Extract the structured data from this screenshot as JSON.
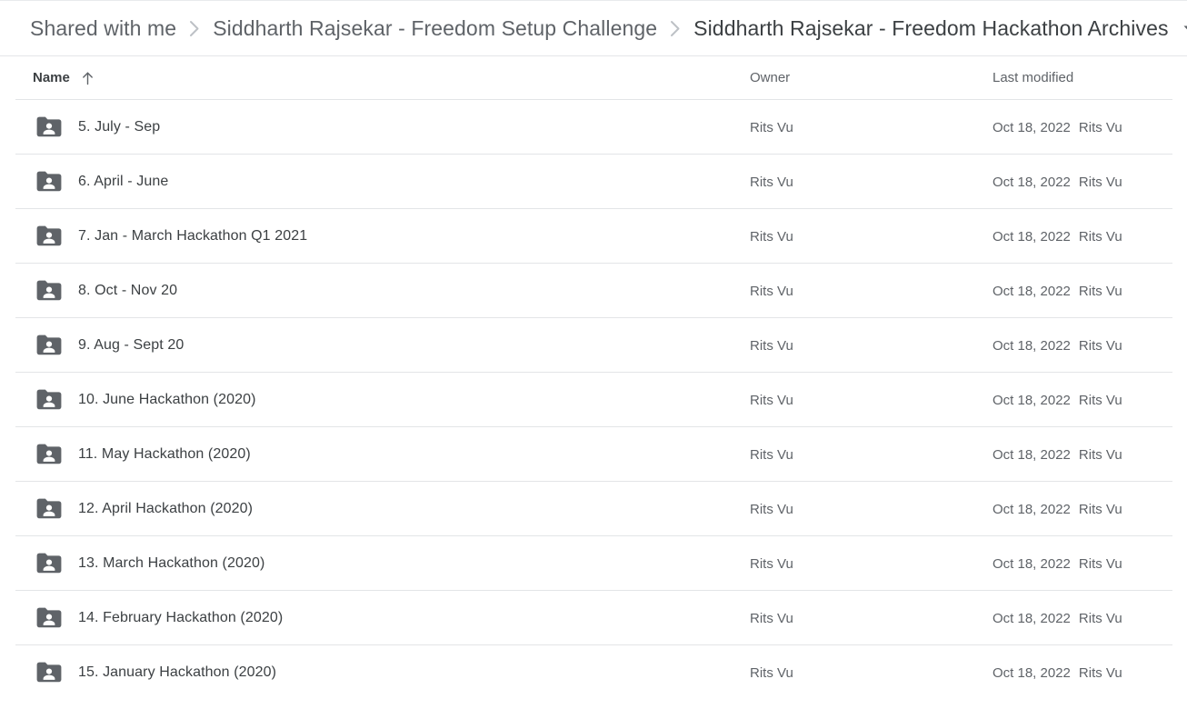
{
  "breadcrumb": {
    "items": [
      {
        "label": "Shared with me",
        "current": false
      },
      {
        "label": "Siddharth Rajsekar - Freedom Setup Challenge",
        "current": false
      },
      {
        "label": "Siddharth Rajsekar - Freedom Hackathon Archives",
        "current": true
      }
    ],
    "separator_icon": "chevron-right-icon",
    "caret_icon": "caret-down-icon"
  },
  "columns": {
    "name": "Name",
    "owner": "Owner",
    "last_modified": "Last modified",
    "sort_icon": "arrow-up-icon",
    "sort_column": "Name",
    "sort_direction": "ascending"
  },
  "colors": {
    "folder_icon": "#5f6368",
    "text_primary": "#3c4043",
    "text_secondary": "#5f6368",
    "divider": "#e3e5e7",
    "breadcrumb_muted": "#5f6368"
  },
  "rows": [
    {
      "icon": "shared-folder-icon",
      "name": "5. July - Sep",
      "owner": "Rits Vu",
      "modified_date": "Oct 18, 2022",
      "modified_by": "Rits Vu"
    },
    {
      "icon": "shared-folder-icon",
      "name": "6. April - June",
      "owner": "Rits Vu",
      "modified_date": "Oct 18, 2022",
      "modified_by": "Rits Vu"
    },
    {
      "icon": "shared-folder-icon",
      "name": "7. Jan - March Hackathon Q1 2021",
      "owner": "Rits Vu",
      "modified_date": "Oct 18, 2022",
      "modified_by": "Rits Vu"
    },
    {
      "icon": "shared-folder-icon",
      "name": "8. Oct - Nov 20",
      "owner": "Rits Vu",
      "modified_date": "Oct 18, 2022",
      "modified_by": "Rits Vu"
    },
    {
      "icon": "shared-folder-icon",
      "name": "9. Aug - Sept 20",
      "owner": "Rits Vu",
      "modified_date": "Oct 18, 2022",
      "modified_by": "Rits Vu"
    },
    {
      "icon": "shared-folder-icon",
      "name": "10. June Hackathon (2020)",
      "owner": "Rits Vu",
      "modified_date": "Oct 18, 2022",
      "modified_by": "Rits Vu"
    },
    {
      "icon": "shared-folder-icon",
      "name": "11. May Hackathon (2020)",
      "owner": "Rits Vu",
      "modified_date": "Oct 18, 2022",
      "modified_by": "Rits Vu"
    },
    {
      "icon": "shared-folder-icon",
      "name": "12. April Hackathon (2020)",
      "owner": "Rits Vu",
      "modified_date": "Oct 18, 2022",
      "modified_by": "Rits Vu"
    },
    {
      "icon": "shared-folder-icon",
      "name": "13. March Hackathon (2020)",
      "owner": "Rits Vu",
      "modified_date": "Oct 18, 2022",
      "modified_by": "Rits Vu"
    },
    {
      "icon": "shared-folder-icon",
      "name": "14. February Hackathon (2020)",
      "owner": "Rits Vu",
      "modified_date": "Oct 18, 2022",
      "modified_by": "Rits Vu"
    },
    {
      "icon": "shared-folder-icon",
      "name": "15. January Hackathon (2020)",
      "owner": "Rits Vu",
      "modified_date": "Oct 18, 2022",
      "modified_by": "Rits Vu"
    }
  ]
}
